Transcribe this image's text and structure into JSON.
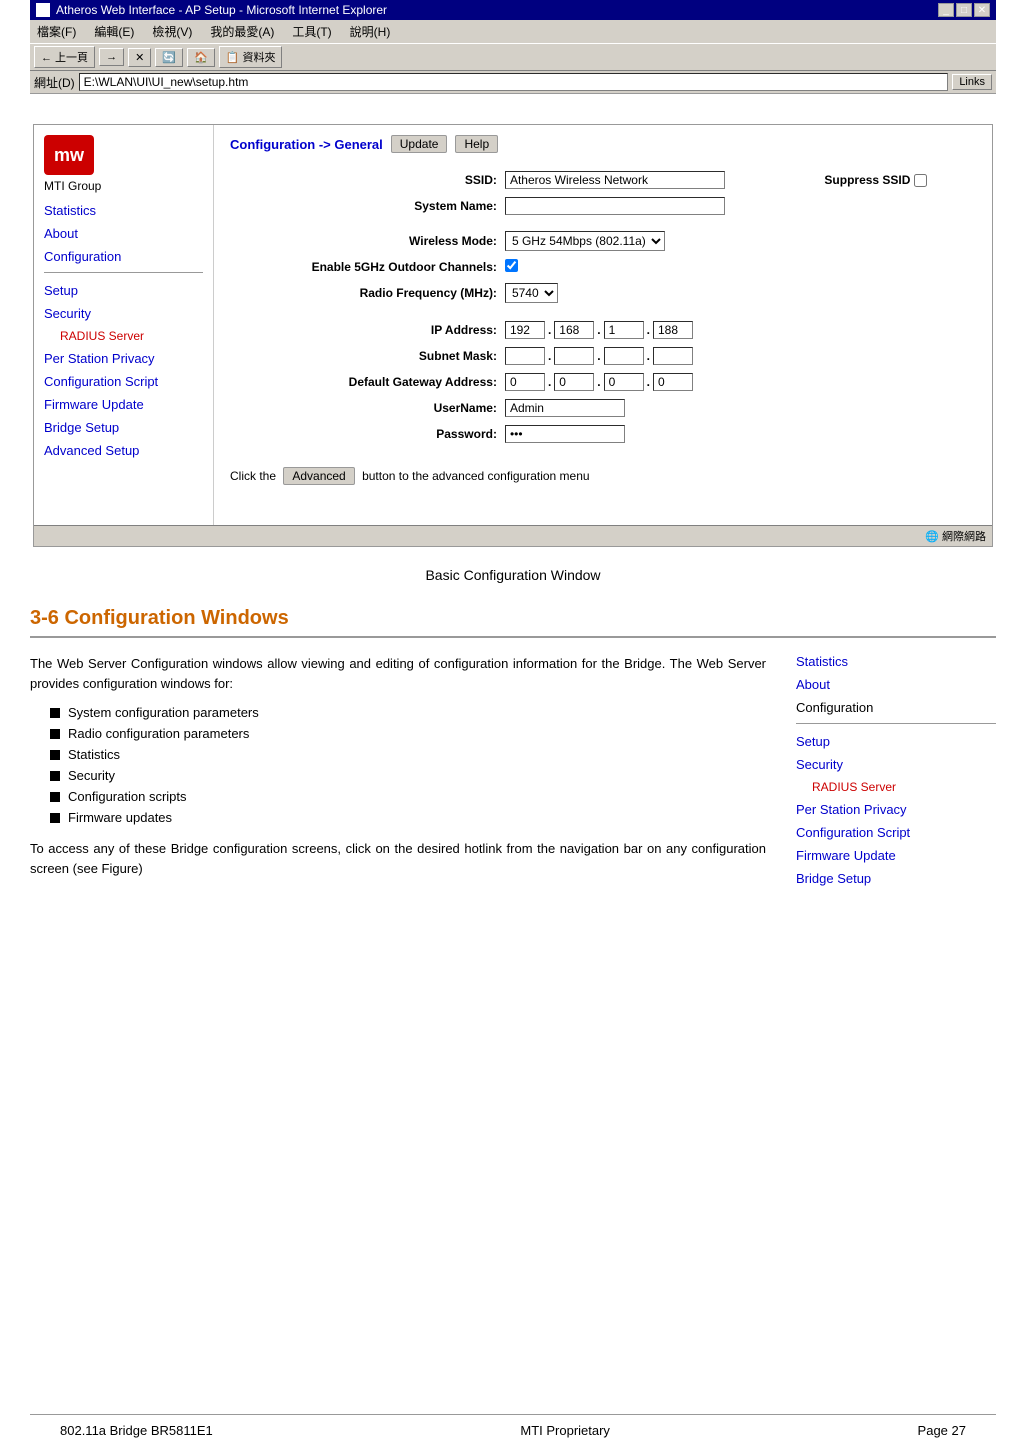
{
  "browser": {
    "title": "Atheros Web Interface - AP Setup - Microsoft Internet Explorer",
    "menu_items": [
      "檔案(F)",
      "編輯(E)",
      "檢視(V)",
      "我的最愛(A)",
      "工具(T)",
      "說明(H)"
    ],
    "toolbar_buttons": [
      "← 上一頁",
      "→",
      "✕",
      "🔄",
      "🏠",
      "📋 資料夾"
    ],
    "address_label": "網址(D)",
    "address_value": "E:\\WLAN\\UI\\UI_new\\setup.htm",
    "links_label": "Links",
    "title_controls": [
      "_",
      "□",
      "✕"
    ]
  },
  "nav": {
    "logo_text": "mw",
    "company": "MTI Group",
    "top_links": [
      {
        "label": "Statistics",
        "href": "#"
      },
      {
        "label": "About",
        "href": "#"
      },
      {
        "label": "Configuration",
        "href": "#"
      }
    ],
    "section_links": [
      {
        "label": "Setup",
        "href": "#",
        "sub": false
      },
      {
        "label": "Security",
        "href": "#",
        "sub": false
      },
      {
        "label": "RADIUS Server",
        "href": "#",
        "sub": true
      },
      {
        "label": "Per Station Privacy",
        "href": "#",
        "sub": false
      },
      {
        "label": "Configuration Script",
        "href": "#",
        "sub": false
      },
      {
        "label": "Firmware Update",
        "href": "#",
        "sub": false
      },
      {
        "label": "Bridge Setup",
        "href": "#",
        "sub": false
      },
      {
        "label": "Advanced Setup",
        "href": "#",
        "sub": false
      }
    ]
  },
  "main": {
    "config_path": "Configuration -> General",
    "update_btn": "Update",
    "help_btn": "Help",
    "fields": {
      "ssid_label": "SSID:",
      "ssid_value": "Atheros Wireless Network",
      "suppress_ssid_label": "Suppress SSID",
      "system_name_label": "System Name:",
      "system_name_value": "",
      "wireless_mode_label": "Wireless Mode:",
      "wireless_mode_value": "5 GHz 54Mbps (802.11a)",
      "outdoor_channels_label": "Enable 5GHz Outdoor Channels:",
      "outdoor_checked": true,
      "radio_freq_label": "Radio Frequency (MHz):",
      "radio_freq_value": "5740",
      "ip_label": "IP Address:",
      "ip1": "192",
      "ip2": "168",
      "ip3": "1",
      "ip4": "188",
      "subnet_label": "Subnet Mask:",
      "subnet1": "",
      "subnet2": "",
      "subnet3": "",
      "subnet4": "",
      "gateway_label": "Default Gateway Address:",
      "gw1": "0",
      "gw2": "0",
      "gw3": "0",
      "gw4": "0",
      "username_label": "UserName:",
      "username_value": "Admin",
      "password_label": "Password:",
      "password_value": "***"
    },
    "advanced_notice": "Click the",
    "advanced_btn": "Advanced",
    "advanced_notice2": "button to the advanced configuration menu"
  },
  "status_bar": {
    "left": "",
    "right": "🌐 網際網路"
  },
  "caption": "Basic Configuration Window",
  "section_title": "3-6 Configuration Windows",
  "body_paragraphs": [
    "The Web Server Configuration windows allow viewing and editing of configuration information for the Bridge. The Web Server provides configuration windows for:"
  ],
  "bullet_items": [
    "System configuration parameters",
    "Radio configuration parameters",
    "Statistics",
    "Security",
    "Configuration scripts",
    "Firmware updates"
  ],
  "body_paragraph2": "To access any of these Bridge configuration screens, click on the desired hotlink from the navigation bar on any configuration screen (see Figure)",
  "right_nav": {
    "links": [
      {
        "label": "Statistics",
        "sub": false,
        "plain": false
      },
      {
        "label": "About",
        "sub": false,
        "plain": false
      },
      {
        "label": "Configuration",
        "sub": false,
        "plain": true
      },
      {
        "label": "Setup",
        "sub": false,
        "plain": false
      },
      {
        "label": "Security",
        "sub": false,
        "plain": false
      },
      {
        "label": "RADIUS Server",
        "sub": true,
        "plain": false
      },
      {
        "label": "Per Station Privacy",
        "sub": false,
        "plain": false
      },
      {
        "label": "Configuration Script",
        "sub": false,
        "plain": false
      },
      {
        "label": "Firmware Update",
        "sub": false,
        "plain": false
      },
      {
        "label": "Bridge Setup",
        "sub": false,
        "plain": false
      }
    ]
  },
  "footer": {
    "left": "802.11a Bridge BR5811E1",
    "center": "MTI Proprietary",
    "right": "Page 27"
  }
}
